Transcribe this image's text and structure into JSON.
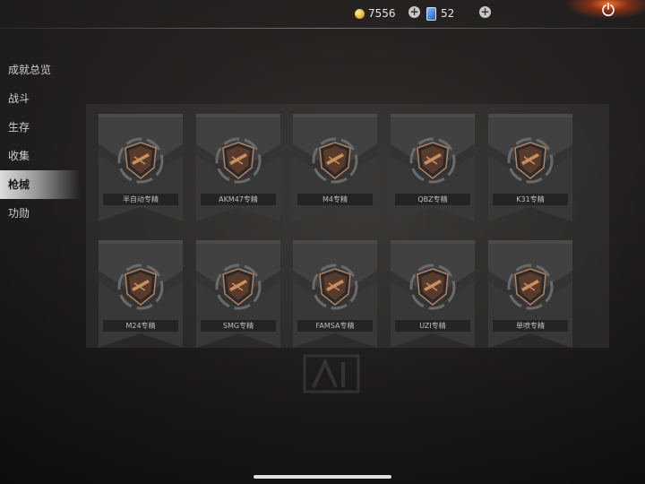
{
  "topbar": {
    "coins": "7556",
    "cards": "52",
    "coin_icon": "coin-icon",
    "card_icon": "card-icon",
    "add_label": "+",
    "power_icon": "power-icon"
  },
  "sidebar": {
    "items": [
      {
        "label": "成就总览",
        "active": false
      },
      {
        "label": "战斗",
        "active": false
      },
      {
        "label": "生存",
        "active": false
      },
      {
        "label": "收集",
        "active": false
      },
      {
        "label": "枪械",
        "active": true
      },
      {
        "label": "功勋",
        "active": false
      }
    ]
  },
  "medals": [
    {
      "label": "半自动专精"
    },
    {
      "label": "AKM47专精"
    },
    {
      "label": "M4专精"
    },
    {
      "label": "QBZ专精"
    },
    {
      "label": "K31专精"
    },
    {
      "label": "M24专精"
    },
    {
      "label": "SMG专精"
    },
    {
      "label": "FAMSA专精"
    },
    {
      "label": "UZI专精"
    },
    {
      "label": "单喷专精"
    }
  ],
  "colors": {
    "banner": "#3b3b3b",
    "emblem": "#8a5a3a",
    "accent_orange": "#e8702a"
  }
}
